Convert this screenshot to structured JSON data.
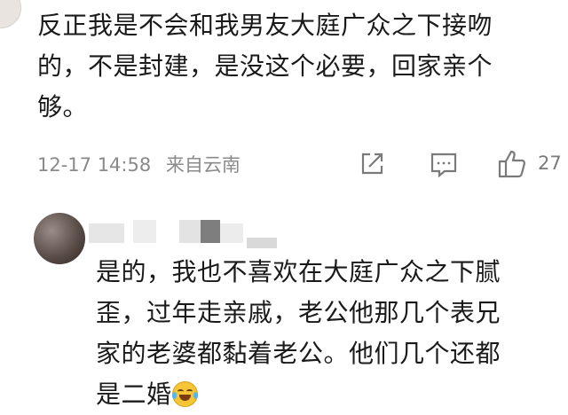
{
  "comment1": {
    "text": "反正我是不会和我男友大庭广众之下接吻\n的，不是封建，是没这个必要，回家亲个\n够。",
    "date": "12-17 14:58",
    "location": "来自云南",
    "like_count": "27",
    "icons": {
      "share": "share-edit-icon",
      "comment": "comment-icon",
      "like": "thumbs-up-icon"
    }
  },
  "reply": {
    "text": "是的，我也不喜欢在大庭广众之下腻\n歪，过年走亲戚，老公他那几个表兄\n家的老婆都黏着老公。他们几个还都\n是二婚",
    "emoji": "laugh-cry-emoji"
  }
}
